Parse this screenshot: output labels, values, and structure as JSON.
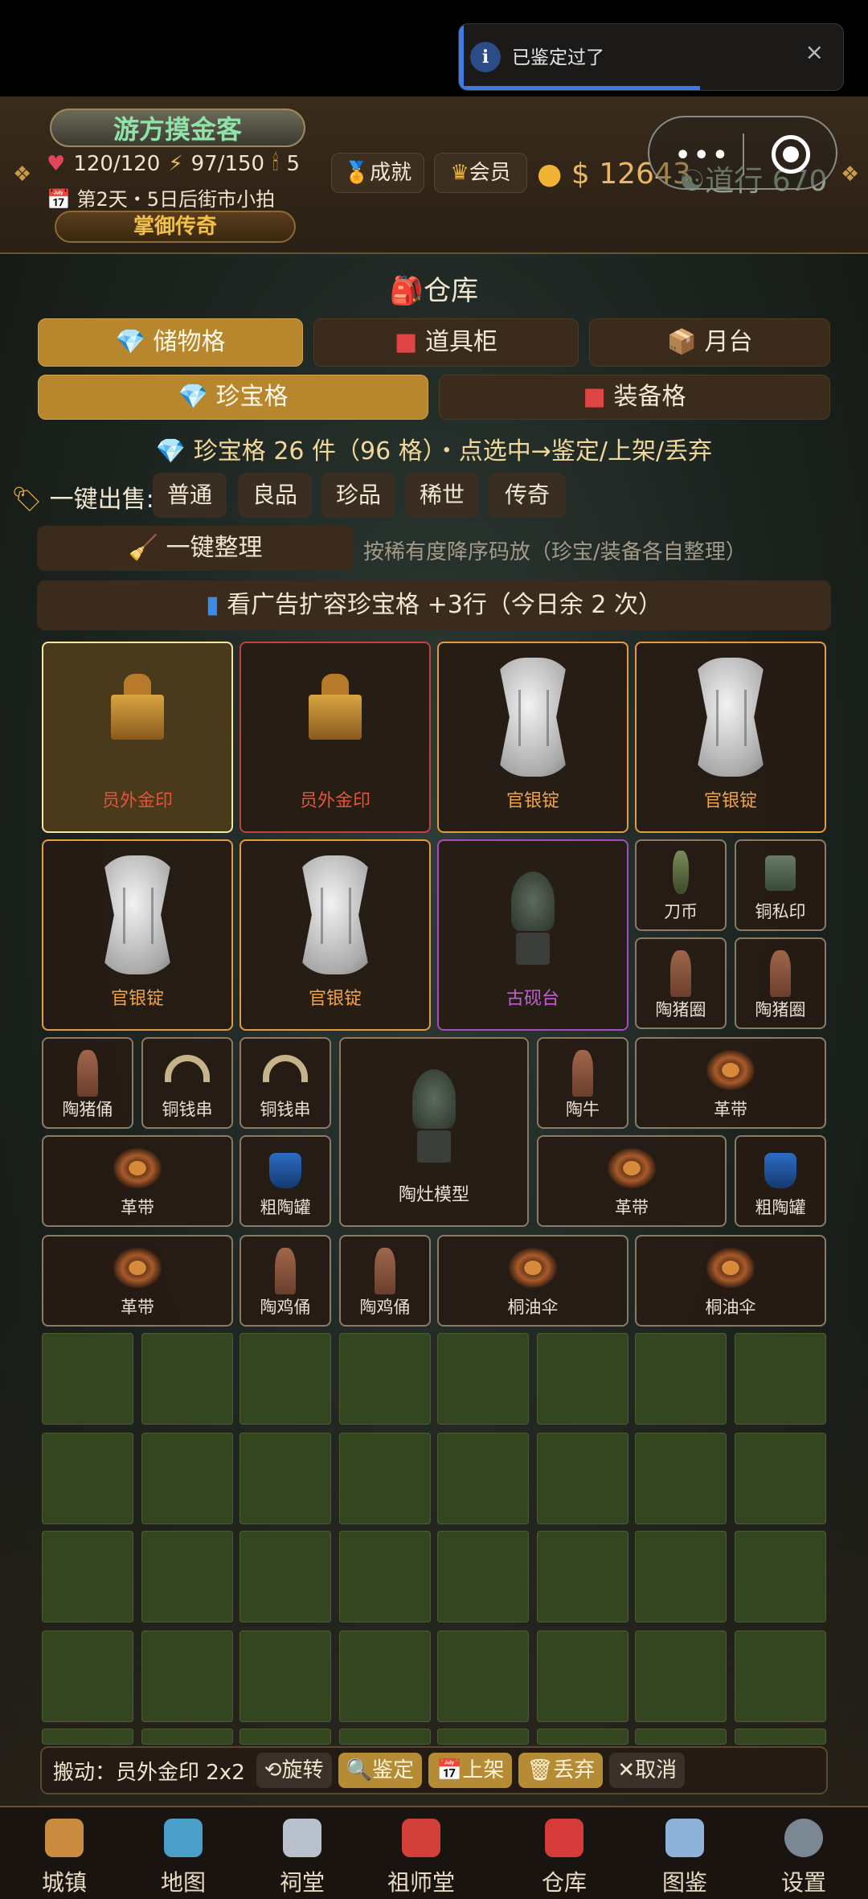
{
  "toast": {
    "message": "已鉴定过了",
    "close": "×"
  },
  "header": {
    "title": "游方摸金客",
    "hp": "120/120",
    "energy": "97/150",
    "candles": "5",
    "day_info": "第2天・5日后街市小拍",
    "legend_badge": "掌御传奇",
    "achievements": "成就",
    "membership": "会员",
    "money": "$ 12643",
    "dao": "道行 670"
  },
  "warehouse": {
    "title": "仓库",
    "tabs": [
      "储物格",
      "道具柜",
      "月台"
    ],
    "subtabs": [
      "珍宝格",
      "装备格"
    ],
    "info": "珍宝格 26 件（96 格）・点选中→鉴定/上架/丢弃",
    "sell_label": "一键出售:",
    "rarities": [
      "普通",
      "良品",
      "珍品",
      "稀世",
      "传奇"
    ],
    "sort_button": "一键整理",
    "sort_hint": "按稀有度降序码放（珍宝/装备各自整理）",
    "ad_button": "看广告扩容珍宝格 +3行（今日余 2 次）"
  },
  "items": [
    {
      "name": "员外金印",
      "icon": "seal-icon"
    },
    {
      "name": "员外金印",
      "icon": "seal-icon"
    },
    {
      "name": "官银锭",
      "icon": "silver-ingot-icon"
    },
    {
      "name": "官银锭",
      "icon": "silver-ingot-icon"
    },
    {
      "name": "官银锭",
      "icon": "silver-ingot-icon"
    },
    {
      "name": "官银锭",
      "icon": "silver-ingot-icon"
    },
    {
      "name": "古砚台",
      "icon": "inkstone-icon"
    },
    {
      "name": "刀币",
      "icon": "knife-coin-icon"
    },
    {
      "name": "铜私印",
      "icon": "bronze-seal-icon"
    },
    {
      "name": "陶猪圈",
      "icon": "figurine-icon"
    },
    {
      "name": "陶猪圈",
      "icon": "figurine-icon"
    },
    {
      "name": "陶猪俑",
      "icon": "figurine-icon"
    },
    {
      "name": "铜钱串",
      "icon": "coin-string-icon"
    },
    {
      "name": "铜钱串",
      "icon": "coin-string-icon"
    },
    {
      "name": "陶灶模型",
      "icon": "stove-model-icon"
    },
    {
      "name": "陶牛",
      "icon": "figurine-icon"
    },
    {
      "name": "革带",
      "icon": "belt-icon"
    },
    {
      "name": "革带",
      "icon": "belt-icon"
    },
    {
      "name": "粗陶罐",
      "icon": "jar-icon"
    },
    {
      "name": "革带",
      "icon": "belt-icon"
    },
    {
      "name": "粗陶罐",
      "icon": "jar-icon"
    },
    {
      "name": "革带",
      "icon": "belt-icon"
    },
    {
      "name": "陶鸡俑",
      "icon": "figurine-icon"
    },
    {
      "name": "陶鸡俑",
      "icon": "figurine-icon"
    },
    {
      "name": "桐油伞",
      "icon": "umbrella-icon"
    },
    {
      "name": "桐油伞",
      "icon": "umbrella-icon"
    }
  ],
  "action_bar": {
    "moving": "搬动：员外金印 2x2",
    "rotate": "旋转",
    "appraise": "鉴定",
    "list": "上架",
    "discard": "丢弃",
    "cancel": "取消"
  },
  "nav": [
    "城镇",
    "地图",
    "祠堂",
    "祖师堂",
    "仓库",
    "图鉴",
    "设置"
  ],
  "colors": {
    "accent": "#b8862c",
    "legendary": "#e4533a",
    "rare": "#f0a24a",
    "epic": "#c35cd6"
  }
}
